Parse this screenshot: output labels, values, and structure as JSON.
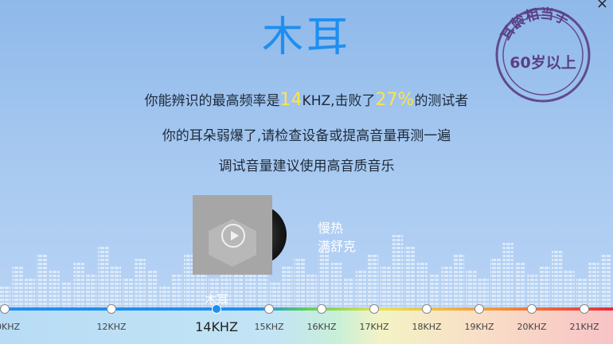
{
  "window": {
    "close_glyph": "×"
  },
  "result": {
    "title": "木耳",
    "stamp_top": "耳龄相当于",
    "stamp_bottom": "60岁以上",
    "line1_prefix": "你能辨识的最高频率是",
    "line1_freq": "14",
    "line1_mid": "KHZ,击败了",
    "line1_percent": "27%",
    "line1_suffix": "的测试者",
    "line2": "你的耳朵弱爆了,请检查设备或提高音量再测一遍",
    "line3": "调试音量建议使用高音质音乐"
  },
  "player": {
    "song_line1": "慢热",
    "song_line2": "满舒克",
    "play_icon": "play-icon"
  },
  "scale": {
    "marker_label": "木耳",
    "ticks": [
      "0KHZ",
      "12KHZ",
      "14KHZ",
      "15KHZ",
      "16KHZ",
      "17KHZ",
      "18KHZ",
      "19KHZ",
      "20KHZ",
      "21KHZ"
    ],
    "active_index": 2
  },
  "colors": {
    "title": "#1e8ff0",
    "highlight": "#ffe34a",
    "stamp": "#5a3f86"
  }
}
